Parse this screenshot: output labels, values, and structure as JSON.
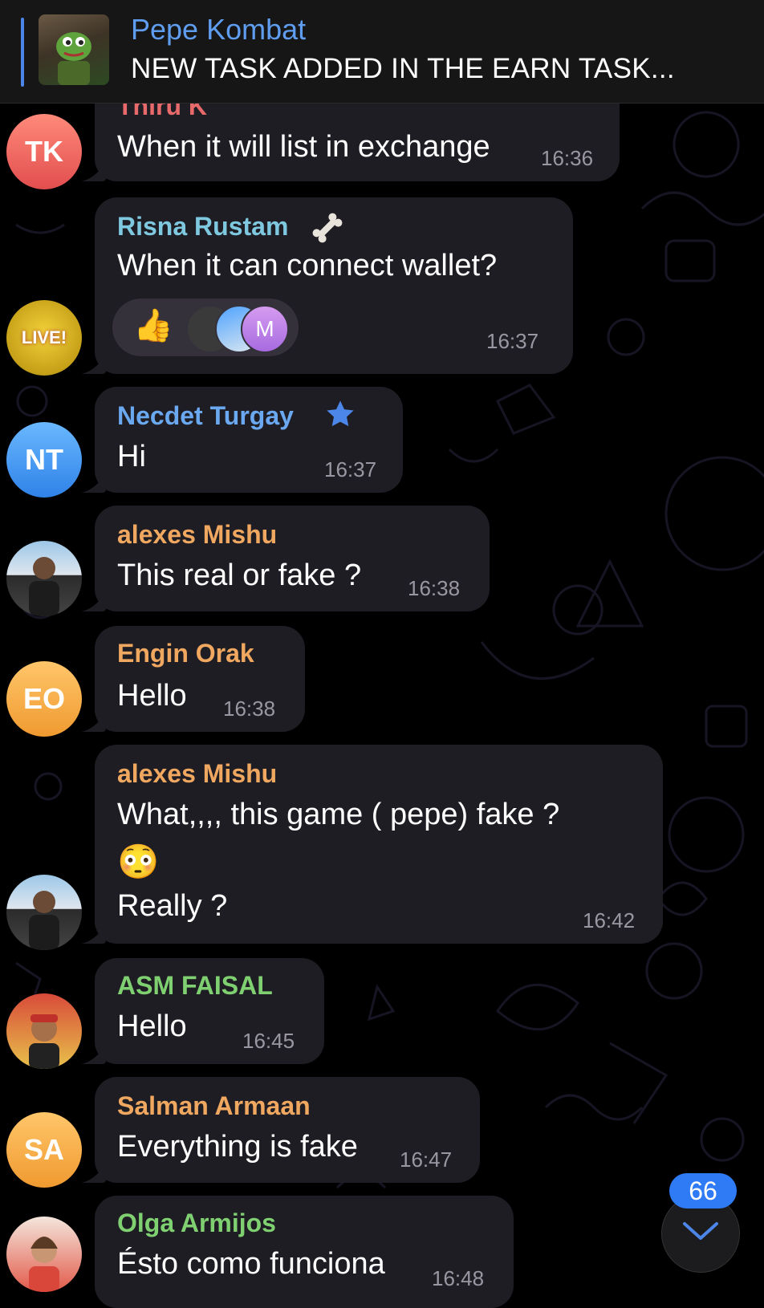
{
  "pinned": {
    "title": "Pepe Kombat",
    "text": "NEW TASK ADDED IN THE EARN TASK..."
  },
  "messages": [
    {
      "sender": "Thiru K",
      "text": "When it will list in exchange",
      "time": "16:36",
      "sender_color": "#e86a6a",
      "avatar_initials": "TK"
    },
    {
      "sender": "Risna Rustam",
      "text": "When it can connect wallet?",
      "time": "16:37",
      "sender_color": "#7fc9e0",
      "avatar_label": "LIVE!",
      "reaction_emoji": "👍",
      "reaction_initial": "M"
    },
    {
      "sender": "Necdet Turgay",
      "text": "Hi",
      "time": "16:37",
      "sender_color": "#6aa8f0",
      "avatar_initials": "NT"
    },
    {
      "sender": "alexes Mishu",
      "text": "This real  or fake ?",
      "time": "16:38",
      "sender_color": "#f0a860"
    },
    {
      "sender": "Engin Orak",
      "text": "Hello",
      "time": "16:38",
      "sender_color": "#f0a860",
      "avatar_initials": "EO"
    },
    {
      "sender": "alexes Mishu",
      "text_line1": "What,,,,  this game ( pepe)  fake ?",
      "emoji": "😳",
      "text_line3": "Really ?",
      "time": "16:42",
      "sender_color": "#f0a860"
    },
    {
      "sender": "ASM FAISAL",
      "text": "Hello",
      "time": "16:45",
      "sender_color": "#7fd070"
    },
    {
      "sender": "Salman Armaan",
      "text": "Everything is fake",
      "time": "16:47",
      "sender_color": "#f0a860",
      "avatar_initials": "SA"
    },
    {
      "sender": "Olga Armijos",
      "text": "Ésto como funciona",
      "time": "16:48",
      "sender_color": "#7fd070"
    }
  ],
  "unread_count": "66",
  "icons": {
    "bone": "bone-icon",
    "star": "star-icon",
    "chevron": "chevron-down-icon"
  }
}
